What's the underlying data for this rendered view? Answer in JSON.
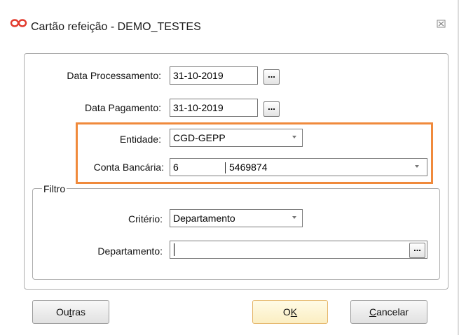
{
  "window": {
    "title": "Cartão refeição - DEMO_TESTES",
    "icon": "infinity-icon",
    "close_icon": "close-icon"
  },
  "fields": {
    "data_processamento": {
      "label": "Data Processamento:",
      "value": "31-10-2019",
      "button": "..."
    },
    "data_pagamento": {
      "label": "Data Pagamento:",
      "value": "31-10-2019",
      "button": "..."
    },
    "entidade": {
      "label": "Entidade:",
      "value": "CGD-GEPP"
    },
    "conta_bancaria": {
      "label": "Conta Bancária:",
      "value_left": "6",
      "value_right": "5469874"
    }
  },
  "filtro": {
    "legend": "Filtro",
    "criterio": {
      "label": "Critério:",
      "value": "Departamento"
    },
    "departamento": {
      "label": "Departamento:",
      "value": "",
      "button": "..."
    }
  },
  "buttons": {
    "outras": {
      "before": "Ou",
      "mnemonic": "t",
      "after": "ras"
    },
    "ok": {
      "before": "O",
      "mnemonic": "K",
      "after": ""
    },
    "cancelar": {
      "before": "",
      "mnemonic": "C",
      "after": "ancelar"
    }
  },
  "colors": {
    "highlight": "#f08a3c",
    "icon_red": "#e23b2e",
    "default_button": "#fbeec2"
  }
}
